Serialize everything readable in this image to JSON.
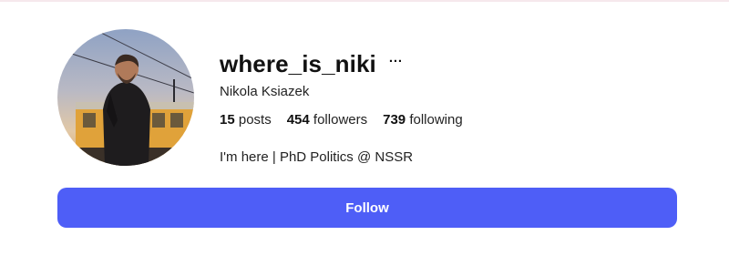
{
  "profile": {
    "username": "where_is_niki",
    "more_label": "···",
    "full_name": "Nikola Ksiazek",
    "stats": {
      "posts_count": "15",
      "posts_label": "posts",
      "followers_count": "454",
      "followers_label": "followers",
      "following_count": "739",
      "following_label": "following"
    },
    "bio": "I'm here | PhD Politics @ NSSR",
    "avatar": "profile-photo-man-with-tram"
  },
  "actions": {
    "follow_label": "Follow"
  },
  "colors": {
    "accent": "#4e5ef7",
    "text": "#111111",
    "background": "#ffffff"
  }
}
